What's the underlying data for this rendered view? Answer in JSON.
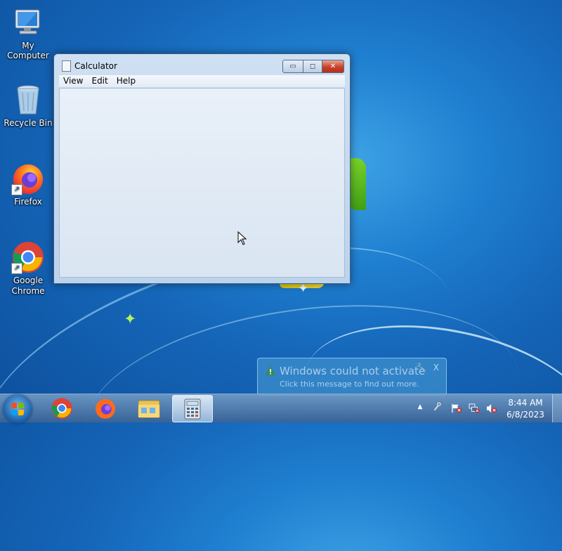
{
  "desktop": {
    "icons": [
      {
        "label": "My Computer"
      },
      {
        "label": "Recycle Bin"
      },
      {
        "label": "Firefox"
      },
      {
        "label": "Google Chrome"
      }
    ]
  },
  "window": {
    "title": "Calculator",
    "menu": [
      "View",
      "Edit",
      "Help"
    ],
    "min_symbol": "▭",
    "max_symbol": "◻",
    "close_symbol": "✕"
  },
  "notification": {
    "title": "Windows could not activate",
    "message": "Click this message to find out more.",
    "close_label": "X"
  },
  "taskbar": {
    "buttons": [
      "Google Chrome",
      "Firefox",
      "Windows Explorer",
      "Calculator"
    ],
    "active": "Calculator"
  },
  "tray": {
    "time": "8:44 AM",
    "date": "6/8/2023",
    "expand_symbol": "▲"
  },
  "colors": {
    "accent": "#1f7fd0",
    "close_red": "#c7412a",
    "warning_green": "#3c8a4a"
  }
}
